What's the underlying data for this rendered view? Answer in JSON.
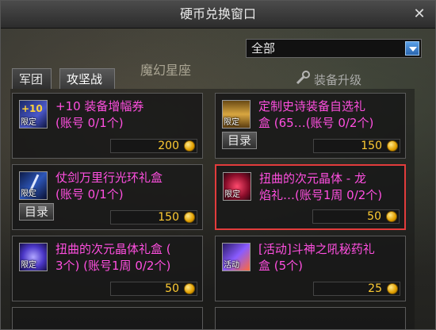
{
  "window": {
    "title": "硬币兑换窗口"
  },
  "filter": {
    "value": "全部"
  },
  "background": {
    "label": "魔幻星座"
  },
  "upgrade": {
    "label": "装备升级"
  },
  "tabs": [
    {
      "label": "军团",
      "active": false
    },
    {
      "label": "攻坚战",
      "active": true
    }
  ],
  "catalog_label": "目录",
  "items": [
    {
      "line1": "+10 装备增幅券",
      "line2": "(账号 0/1个)",
      "price": "200",
      "badge": "限定",
      "icon": "amplify-ticket-icon",
      "catalog": false,
      "selected": false
    },
    {
      "line1": "定制史诗装备自选礼",
      "line2": "盒 (65…(账号 0/2个)",
      "price": "150",
      "badge": "限定",
      "icon": "epic-chest-icon",
      "catalog": true,
      "selected": false
    },
    {
      "line1": "仗剑万里行光环礼盒",
      "line2": "(账号 0/1个)",
      "price": "150",
      "badge": "限定",
      "icon": "sword-aura-icon",
      "catalog": true,
      "selected": false
    },
    {
      "line1": "扭曲的次元晶体 - 龙",
      "line2": "焰礼…(账号1周 0/2个)",
      "price": "50",
      "badge": "限定",
      "icon": "dimension-crystal-icon",
      "catalog": false,
      "selected": true
    },
    {
      "line1": "扭曲的次元晶体礼盒 (",
      "line2": "3个) (账号1周 0/2个)",
      "price": "50",
      "badge": "限定",
      "icon": "crystal-box-icon",
      "catalog": false,
      "selected": false
    },
    {
      "line1": "[活动]斗神之吼秘药礼",
      "line2": "盒 (5个)",
      "price": "25",
      "badge": "活动",
      "icon": "potion-box-icon",
      "catalog": false,
      "selected": false
    }
  ]
}
